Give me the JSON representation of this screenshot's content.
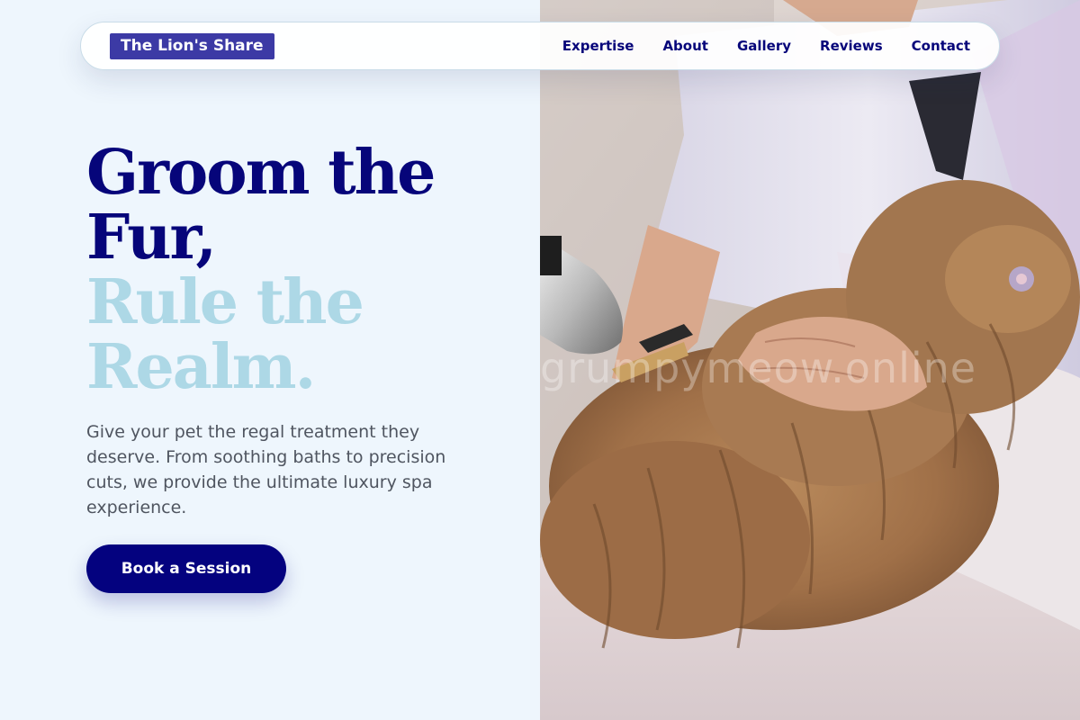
{
  "brand": {
    "logo_text": "The Lion's Share"
  },
  "nav": {
    "links": [
      {
        "label": "Expertise"
      },
      {
        "label": "About"
      },
      {
        "label": "Gallery"
      },
      {
        "label": "Reviews"
      },
      {
        "label": "Contact"
      }
    ]
  },
  "hero": {
    "headline_dark": [
      "Groom the",
      "Fur,"
    ],
    "headline_light": [
      "Rule the",
      "Realm."
    ],
    "subtext": "Give your pet the regal treatment they deserve. From soothing baths to precision cuts, we provide the ultimate luxury spa experience.",
    "cta_label": "Book a Session"
  },
  "image": {
    "watermark": "grumpymeow.online"
  },
  "colors": {
    "primary": "#06057a",
    "accent_light": "#add8e6",
    "logo_bg": "#3c3aa5",
    "page_bg": "#eef6fd",
    "body_text": "#4f5560"
  }
}
